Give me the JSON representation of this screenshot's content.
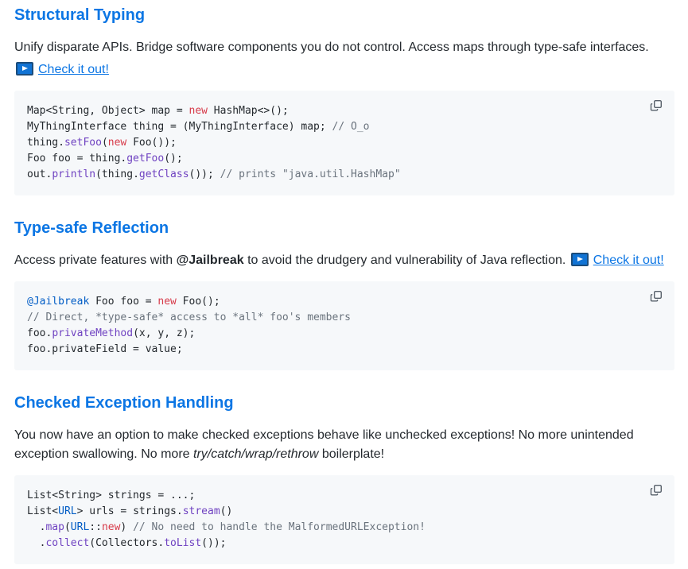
{
  "colors": {
    "heading": "#0c76e4",
    "link": "#0c76e4",
    "text": "#24292e",
    "code_plain": "#24292e",
    "code_keyword": "#d73a49",
    "code_function": "#6f42c1",
    "code_entity": "#005cc5",
    "code_comment": "#6a737d",
    "code_bg": "#f6f8fa",
    "icon": "#57606a"
  },
  "icons": {
    "play": "play-icon",
    "copy": "copy-icon"
  },
  "link_label": "Check it out!",
  "sections": [
    {
      "heading": "Structural Typing",
      "paragraph": [
        {
          "t": "Unify disparate APIs. Bridge software components you do not control. Access maps through type-safe interfaces."
        }
      ],
      "link_row": [
        {
          "t": "Check it out!",
          "link": true
        }
      ],
      "code": [
        [
          [
            "Map<String, Object> map = ",
            "p"
          ],
          [
            "new",
            "k"
          ],
          [
            " HashMap<>();",
            "p"
          ]
        ],
        [
          [
            "MyThingInterface thing = (MyThingInterface) map; ",
            "p"
          ],
          [
            "// O_o",
            "c"
          ]
        ],
        [
          [
            "thing.",
            "p"
          ],
          [
            "setFoo",
            "f"
          ],
          [
            "(",
            "p"
          ],
          [
            "new",
            "k"
          ],
          [
            " Foo());",
            "p"
          ]
        ],
        [
          [
            "Foo foo = thing.",
            "p"
          ],
          [
            "getFoo",
            "f"
          ],
          [
            "();",
            "p"
          ]
        ],
        [
          [
            "out.",
            "p"
          ],
          [
            "println",
            "f"
          ],
          [
            "(thing.",
            "p"
          ],
          [
            "getClass",
            "f"
          ],
          [
            "()); ",
            "p"
          ],
          [
            "// prints \"java.util.HashMap\"",
            "c"
          ]
        ]
      ]
    },
    {
      "heading": "Type-safe Reflection",
      "paragraph": [
        {
          "t": "Access private features with "
        },
        {
          "t": "@Jailbreak",
          "b": true
        },
        {
          "t": " to avoid the drudgery and vulnerability of Java reflection. "
        },
        {
          "t": "Check it out!",
          "link": true
        }
      ],
      "code": [
        [
          [
            "@Jailbreak",
            "e"
          ],
          [
            " Foo foo = ",
            "p"
          ],
          [
            "new",
            "k"
          ],
          [
            " Foo();",
            "p"
          ]
        ],
        [
          [
            "// Direct, *type-safe* access to *all* foo's members",
            "c"
          ]
        ],
        [
          [
            "foo.",
            "p"
          ],
          [
            "privateMethod",
            "f"
          ],
          [
            "(x, y, z);",
            "p"
          ]
        ],
        [
          [
            "foo.privateField = value;",
            "p"
          ]
        ]
      ]
    },
    {
      "heading": "Checked Exception Handling",
      "paragraph": [
        {
          "t": "You now have an option to make checked exceptions behave like unchecked exceptions! No more unintended exception swallowing. No more "
        },
        {
          "t": "try/catch/wrap/rethrow",
          "i": true
        },
        {
          "t": " boilerplate!"
        }
      ],
      "code": [
        [
          [
            "List<String> strings = ...;",
            "p"
          ]
        ],
        [
          [
            "List<",
            "p"
          ],
          [
            "URL",
            "e"
          ],
          [
            "> urls = strings.",
            "p"
          ],
          [
            "stream",
            "f"
          ],
          [
            "()",
            "p"
          ]
        ],
        [
          [
            "  .",
            "p"
          ],
          [
            "map",
            "f"
          ],
          [
            "(",
            "p"
          ],
          [
            "URL",
            "e"
          ],
          [
            "::",
            "p"
          ],
          [
            "new",
            "k"
          ],
          [
            ") ",
            "p"
          ],
          [
            "// No need to handle the MalformedURLException!",
            "c"
          ]
        ],
        [
          [
            "  .",
            "p"
          ],
          [
            "collect",
            "f"
          ],
          [
            "(Collectors.",
            "p"
          ],
          [
            "toList",
            "f"
          ],
          [
            "());",
            "p"
          ]
        ]
      ]
    }
  ]
}
